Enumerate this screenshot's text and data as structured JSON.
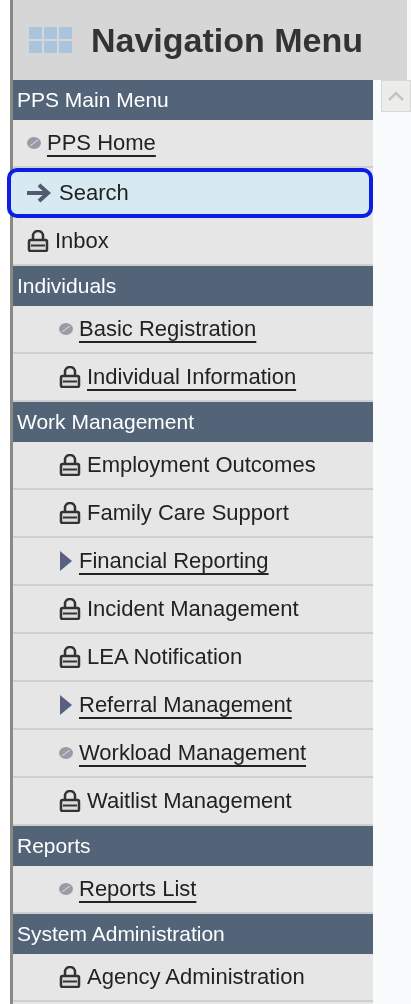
{
  "title": "Navigation Menu",
  "sections": [
    {
      "title": "PPS Main Menu",
      "kind": "main",
      "items": [
        {
          "label": "PPS Home",
          "kind": "disc",
          "link": true,
          "selected": false
        },
        {
          "label": "Search",
          "kind": "arrow",
          "link": false,
          "selected": true
        },
        {
          "label": "Inbox",
          "kind": "lock",
          "link": false,
          "selected": false
        }
      ]
    },
    {
      "title": "Individuals",
      "kind": "group",
      "items": [
        {
          "label": "Basic Registration",
          "kind": "disc",
          "link": true,
          "selected": false
        },
        {
          "label": "Individual Information",
          "kind": "lock",
          "link": true,
          "selected": false
        }
      ]
    },
    {
      "title": "Work Management",
      "kind": "group",
      "items": [
        {
          "label": "Employment Outcomes",
          "kind": "lock",
          "link": false,
          "selected": false
        },
        {
          "label": "Family Care Support",
          "kind": "lock",
          "link": false,
          "selected": false
        },
        {
          "label": "Financial Reporting",
          "kind": "triangle",
          "link": true,
          "selected": false
        },
        {
          "label": "Incident Management",
          "kind": "lock",
          "link": false,
          "selected": false
        },
        {
          "label": "LEA Notification",
          "kind": "lock",
          "link": false,
          "selected": false
        },
        {
          "label": "Referral Management",
          "kind": "triangle",
          "link": true,
          "selected": false
        },
        {
          "label": "Workload Management",
          "kind": "disc",
          "link": true,
          "selected": false
        },
        {
          "label": "Waitlist Management",
          "kind": "lock",
          "link": false,
          "selected": false
        }
      ]
    },
    {
      "title": "Reports",
      "kind": "group",
      "items": [
        {
          "label": "Reports List",
          "kind": "disc",
          "link": true,
          "selected": false
        }
      ]
    },
    {
      "title": "System Administration",
      "kind": "group",
      "items": [
        {
          "label": "Agency Administration",
          "kind": "lock",
          "link": false,
          "selected": false
        }
      ]
    }
  ]
}
